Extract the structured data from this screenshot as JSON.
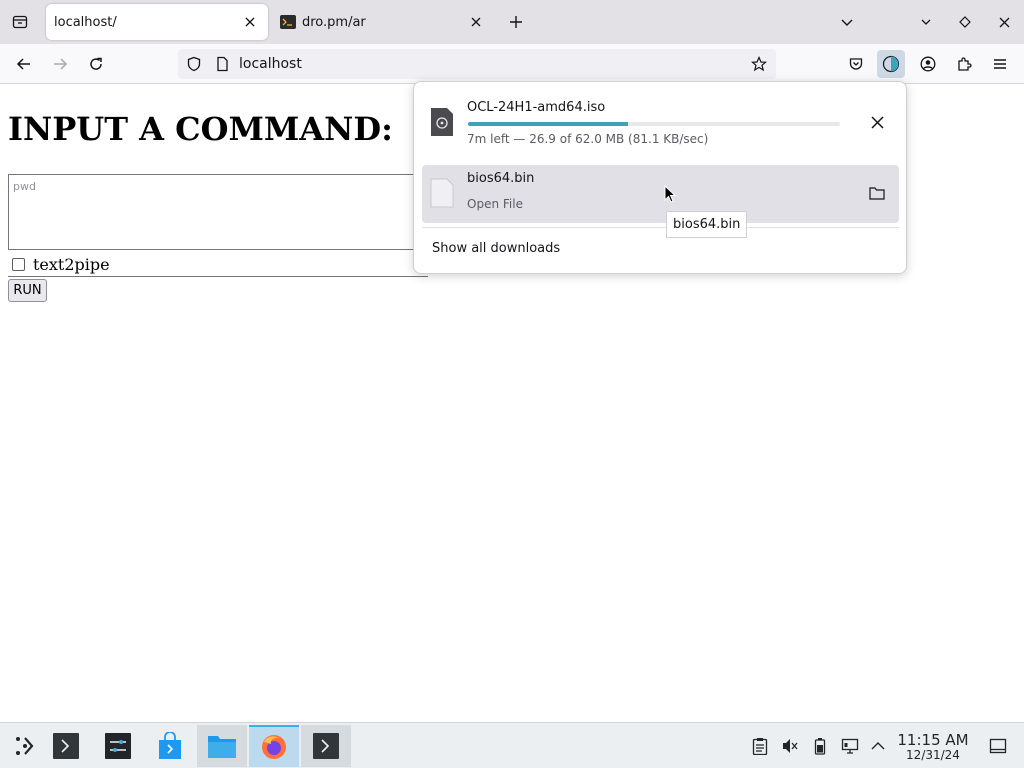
{
  "browser": {
    "tabs": [
      {
        "title": "localhost/"
      },
      {
        "title": "dro.pm/ar"
      }
    ],
    "url": "localhost",
    "accent_color": "#3ea2b8"
  },
  "page": {
    "heading": "INPUT A COMMAND:",
    "command_placeholder": "pwd",
    "pipe_label": "text2pipe",
    "run_label": "RUN"
  },
  "downloads": {
    "items": [
      {
        "name": "OCL-24H1-amd64.iso",
        "status": "7m left — 26.9 of 62.0 MB (81.1 KB/sec)",
        "progress_percent": 43
      },
      {
        "name": "bios64.bin",
        "status": "Open File"
      }
    ],
    "show_all_label": "Show all downloads",
    "tooltip": "bios64.bin"
  },
  "taskbar": {
    "time": "11:15 AM",
    "date": "12/31/24",
    "apps": [
      "app-launcher",
      "terminal",
      "settings",
      "discover",
      "file-manager",
      "firefox",
      "terminal"
    ]
  }
}
